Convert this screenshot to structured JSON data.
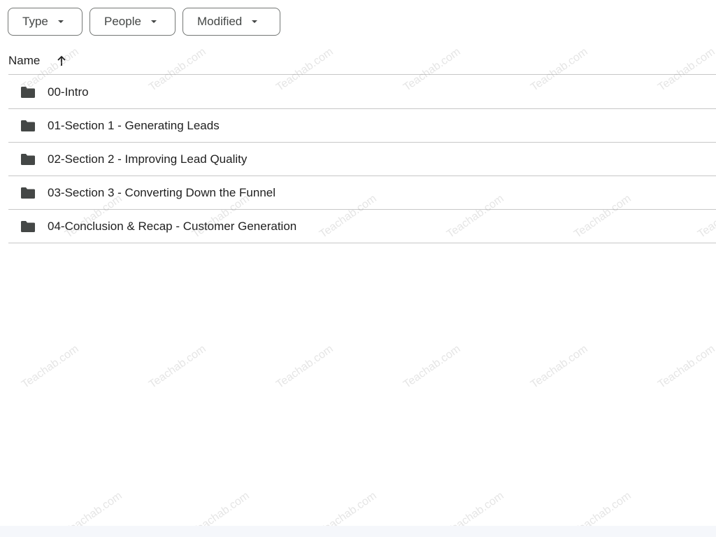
{
  "filters": {
    "type_label": "Type",
    "people_label": "People",
    "modified_label": "Modified"
  },
  "header": {
    "name_label": "Name",
    "sort_icon": "arrow-up-icon"
  },
  "folders": [
    {
      "label": "00-Intro",
      "icon": "folder-icon"
    },
    {
      "label": "01-Section 1 - Generating Leads",
      "icon": "folder-icon"
    },
    {
      "label": "02-Section 2 - Improving Lead Quality",
      "icon": "folder-icon"
    },
    {
      "label": "03-Section 3 - Converting Down the Funnel",
      "icon": "folder-icon"
    },
    {
      "label": "04-Conclusion & Recap - Customer Generation",
      "icon": "folder-icon"
    }
  ],
  "watermark": "Teachab.com",
  "colors": {
    "border": "#747775",
    "divider": "#c7c7c7",
    "icon": "#444746",
    "text": "#1f1f1f"
  }
}
